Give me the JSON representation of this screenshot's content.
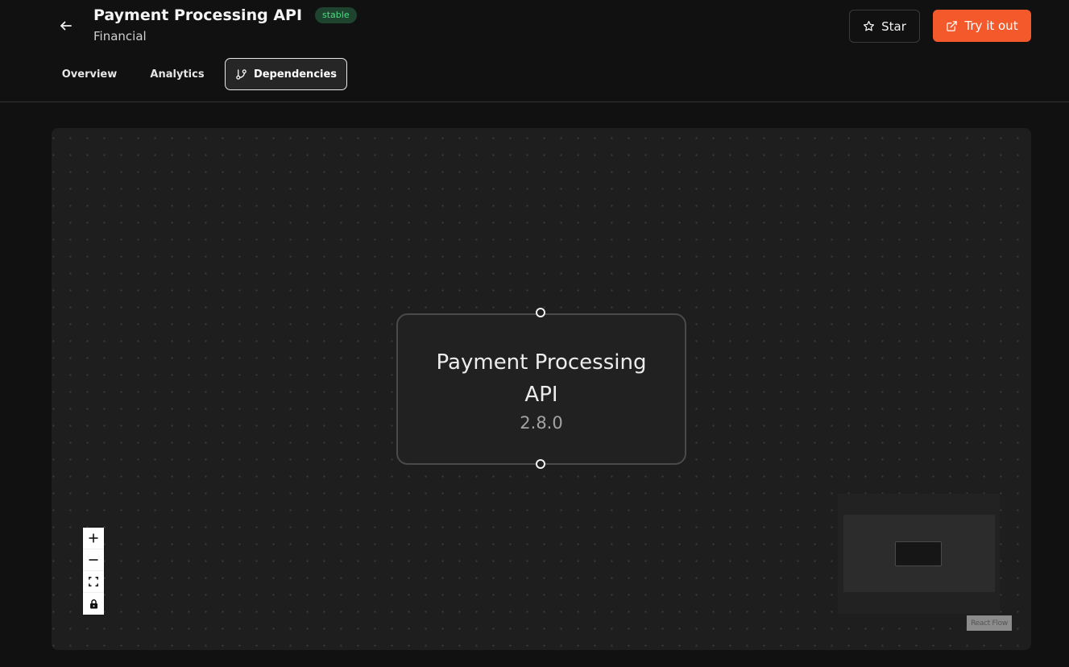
{
  "header": {
    "back_icon": "arrow-left-icon",
    "title": "Payment Processing API",
    "status_badge": "stable",
    "category": "Financial",
    "star_label": "Star",
    "star_icon": "star-icon",
    "try_label": "Try it out",
    "try_icon": "external-link-icon",
    "accent_color": "#f4592b",
    "badge_color": "#4ade80"
  },
  "tabs": [
    {
      "label": "Overview",
      "active": false
    },
    {
      "label": "Analytics",
      "active": false
    },
    {
      "label": "Dependencies",
      "active": true,
      "icon": "git-branch-icon"
    }
  ],
  "flow": {
    "node": {
      "title": "Payment Processing API",
      "version": "2.8.0"
    },
    "controls": [
      "zoom-in-icon",
      "zoom-out-icon",
      "fit-view-icon",
      "lock-icon"
    ],
    "attribution": "React Flow"
  }
}
